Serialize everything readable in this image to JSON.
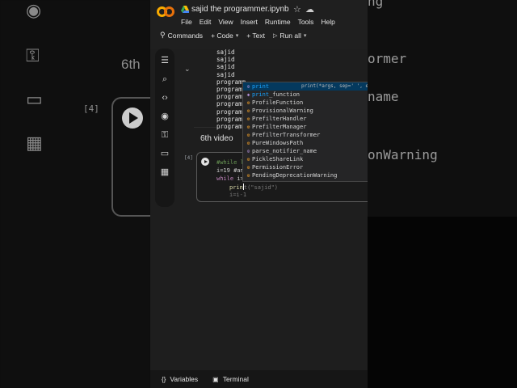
{
  "header": {
    "title": "sajid the programmer.ipynb",
    "menu": [
      "File",
      "Edit",
      "View",
      "Insert",
      "Runtime",
      "Tools",
      "Help"
    ]
  },
  "toolbar": {
    "commands": "Commands",
    "code": "+ Code",
    "text": "+ Text",
    "run_all": "Run all"
  },
  "output_lines": [
    "sajid",
    "sajid",
    "sajid",
    "sajid",
    "programm",
    "programm",
    "programm",
    "programm",
    "programm",
    "programm",
    "programm"
  ],
  "markdown_text": "6th video",
  "cell": {
    "number": "[4]",
    "line1": "#while l",
    "line2": "i=19 #an",
    "line3_kw": "while",
    "line3_rest": " i>",
    "line4_typed": "prin",
    "line4_ghost": "t(\"sajid\")",
    "line5_ghost": "i=i-1"
  },
  "autocomplete": {
    "items": [
      {
        "label": "print",
        "match": "print",
        "icon": "function-icon",
        "detail": "print(*args, sep=' ', e"
      },
      {
        "label": "print_function",
        "match": "print",
        "icon": "variable-icon",
        "detail": ""
      },
      {
        "label": "ProfileFunction",
        "match": "",
        "icon": "class-icon",
        "detail": ""
      },
      {
        "label": "ProvisionalWarning",
        "match": "",
        "icon": "class-icon",
        "detail": ""
      },
      {
        "label": "PrefilterHandler",
        "match": "",
        "icon": "class-icon",
        "detail": ""
      },
      {
        "label": "PrefilterManager",
        "match": "",
        "icon": "class-icon",
        "detail": ""
      },
      {
        "label": "PrefilterTransformer",
        "match": "",
        "icon": "class-icon",
        "detail": ""
      },
      {
        "label": "PureWindowsPath",
        "match": "",
        "icon": "class-icon",
        "detail": ""
      },
      {
        "label": "parse_notifier_name",
        "match": "",
        "icon": "function-icon",
        "detail": ""
      },
      {
        "label": "PickleShareLink",
        "match": "",
        "icon": "class-icon",
        "detail": ""
      },
      {
        "label": "PermissionError",
        "match": "",
        "icon": "class-icon",
        "detail": ""
      },
      {
        "label": "PendingDeprecationWarning",
        "match": "",
        "icon": "class-icon",
        "detail": ""
      }
    ]
  },
  "bottom": {
    "variables": "Variables",
    "terminal": "Terminal"
  },
  "background": {
    "left_heading": "6th",
    "left_cell": "[4]",
    "right_lines": [
      "ng",
      "ormer",
      "name",
      "onWarning"
    ]
  },
  "colors": {
    "logo_orange": "#f9ab00",
    "logo_dark_orange": "#e8710a",
    "selection": "#04395e",
    "match": "#18a3ff"
  }
}
